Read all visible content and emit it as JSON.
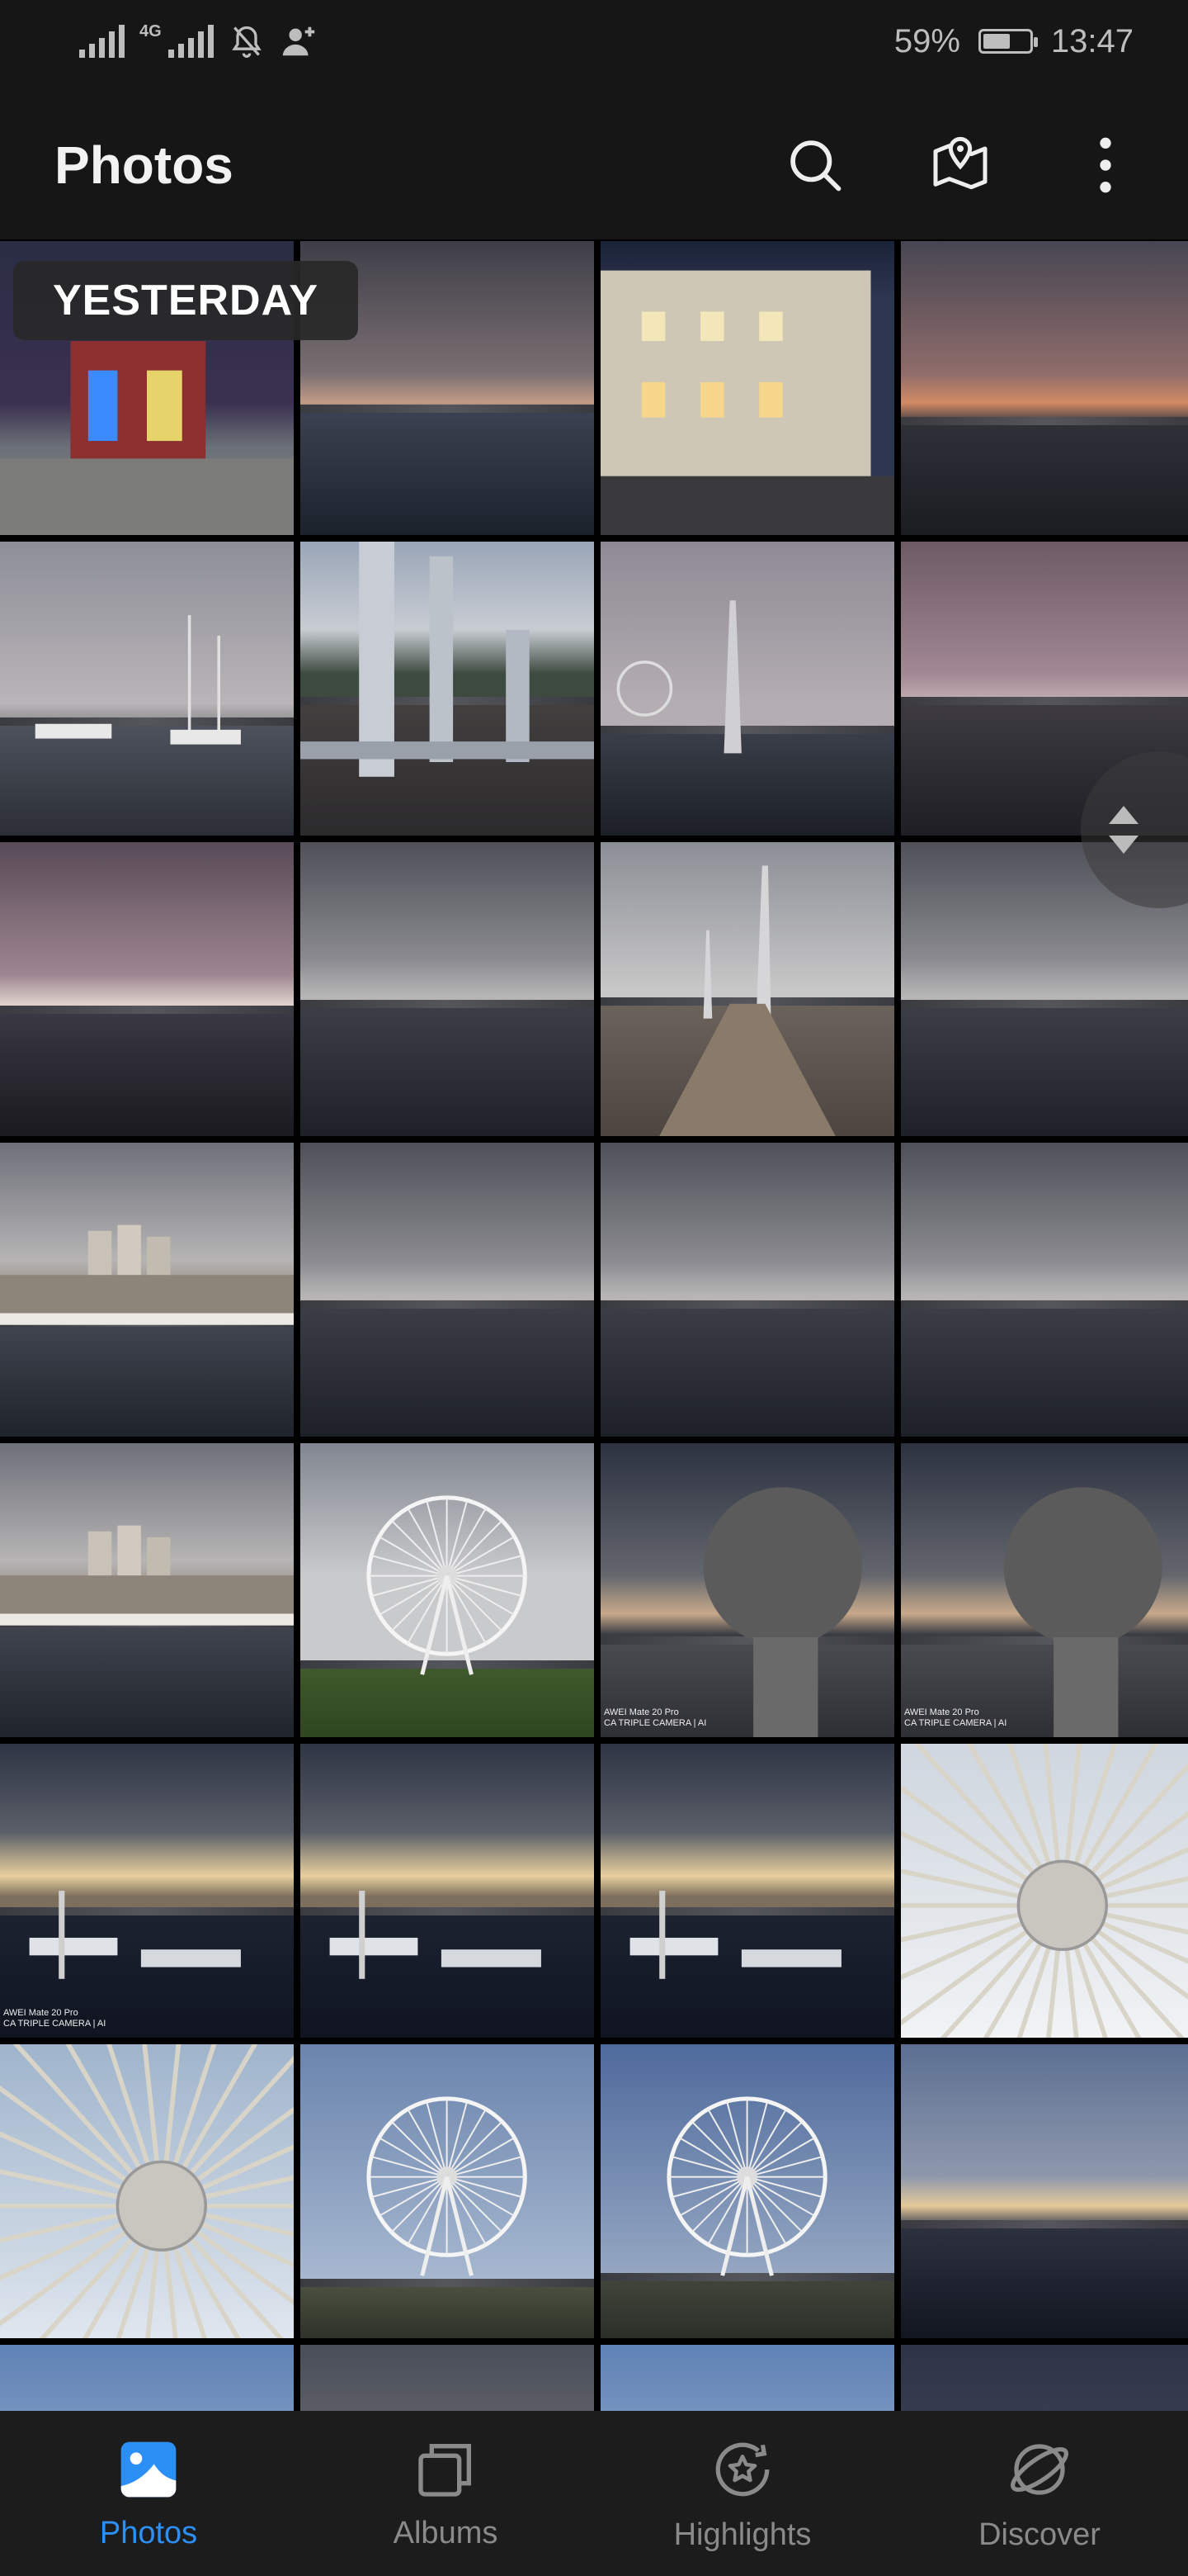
{
  "status_bar": {
    "network_label": "4G",
    "battery_percent": "59%",
    "battery_level": 0.59,
    "time": "13:47",
    "icons": [
      "signal-icon",
      "signal-4g-icon",
      "bell-muted-icon",
      "add-contact-icon",
      "battery-icon"
    ]
  },
  "app_bar": {
    "title": "Photos",
    "actions": [
      "search-icon",
      "map-pin-icon",
      "more-vertical-icon"
    ]
  },
  "grid": {
    "section_label": "YESTERDAY",
    "watermark_text": "AWEI Mate 20 Pro\nCA TRIPLE CAMERA | AI",
    "tiles": [
      {
        "scene": "night-shop"
      },
      {
        "scene": "marina-dusk"
      },
      {
        "scene": "hotel-night"
      },
      {
        "scene": "marina-sunset"
      },
      {
        "scene": "harbor-boats"
      },
      {
        "scene": "pier-pillars"
      },
      {
        "scene": "ferris-harbor"
      },
      {
        "scene": "pink-harbor"
      },
      {
        "scene": "pink-sky-harbor"
      },
      {
        "scene": "gray-harbor"
      },
      {
        "scene": "bridge-walk"
      },
      {
        "scene": "gray-harbor"
      },
      {
        "scene": "town-harbor"
      },
      {
        "scene": "gray-harbor"
      },
      {
        "scene": "gray-harbor"
      },
      {
        "scene": "gray-harbor"
      },
      {
        "scene": "town-harbor"
      },
      {
        "scene": "ferris-park"
      },
      {
        "scene": "stone-ball",
        "watermark": true
      },
      {
        "scene": "stone-ball",
        "watermark": true
      },
      {
        "scene": "sunset-boats",
        "watermark": true
      },
      {
        "scene": "sunset-boats"
      },
      {
        "scene": "sunset-boats"
      },
      {
        "scene": "wheel-close"
      },
      {
        "scene": "wheel-close-blue"
      },
      {
        "scene": "ferris-blue"
      },
      {
        "scene": "ferris-blue-far"
      },
      {
        "scene": "sunset-sea"
      },
      {
        "scene": "sky-blue"
      },
      {
        "scene": "sky-gray"
      },
      {
        "scene": "sky-blue"
      },
      {
        "scene": "sky-dark"
      }
    ]
  },
  "colors": {
    "accent": "#2b8ff5",
    "inactive": "#8a8a8a",
    "topbar_bg": "#161616",
    "nav_bg": "#1c1c1c"
  },
  "bottom_nav": {
    "items": [
      {
        "label": "Photos",
        "icon": "photos-icon",
        "active": true
      },
      {
        "label": "Albums",
        "icon": "albums-icon",
        "active": false
      },
      {
        "label": "Highlights",
        "icon": "highlights-icon",
        "active": false
      },
      {
        "label": "Discover",
        "icon": "discover-icon",
        "active": false
      }
    ]
  }
}
